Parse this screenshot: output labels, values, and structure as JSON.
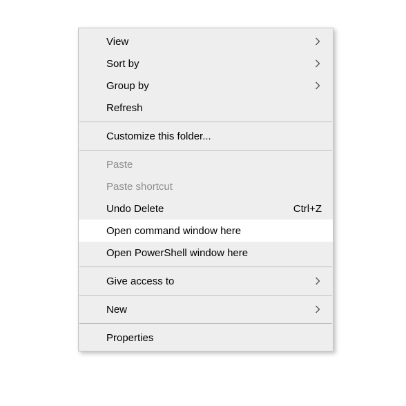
{
  "menu": {
    "items": [
      {
        "label": "View",
        "submenu": true
      },
      {
        "label": "Sort by",
        "submenu": true
      },
      {
        "label": "Group by",
        "submenu": true
      },
      {
        "label": "Refresh"
      },
      {
        "separator": true
      },
      {
        "label": "Customize this folder..."
      },
      {
        "separator": true
      },
      {
        "label": "Paste",
        "disabled": true
      },
      {
        "label": "Paste shortcut",
        "disabled": true
      },
      {
        "label": "Undo Delete",
        "shortcut": "Ctrl+Z"
      },
      {
        "label": "Open command window here",
        "highlight": true
      },
      {
        "label": "Open PowerShell window here"
      },
      {
        "separator": true
      },
      {
        "label": "Give access to",
        "submenu": true
      },
      {
        "separator": true
      },
      {
        "label": "New",
        "submenu": true
      },
      {
        "separator": true
      },
      {
        "label": "Properties"
      }
    ]
  }
}
